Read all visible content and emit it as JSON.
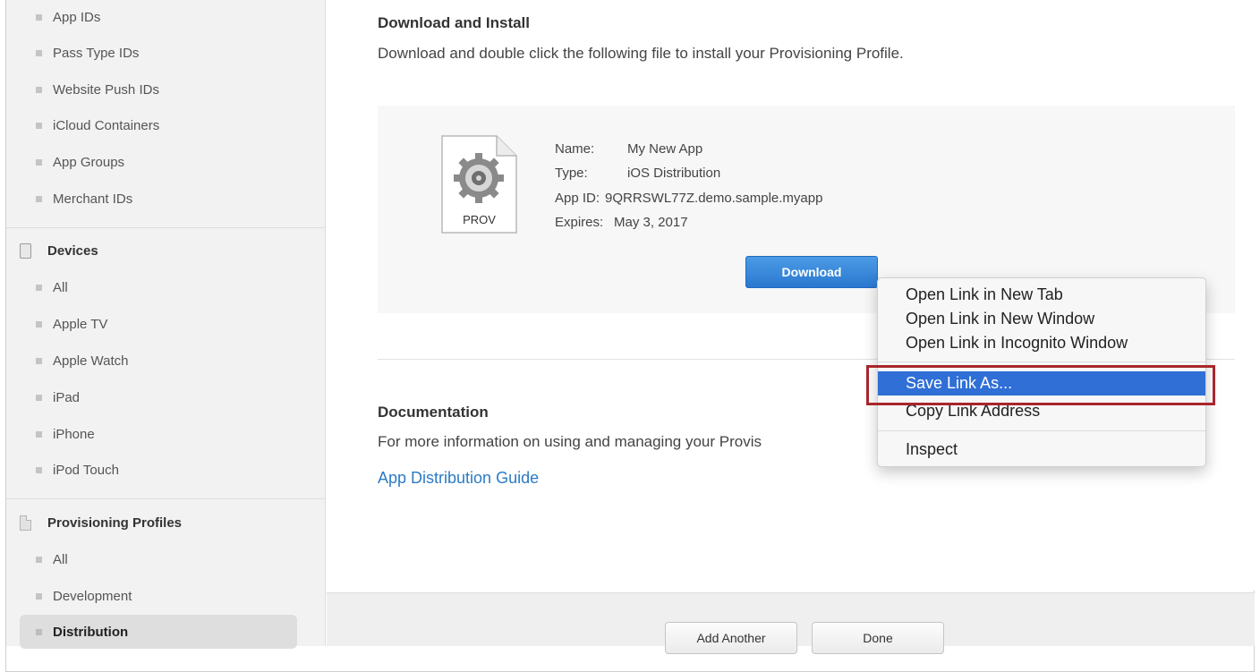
{
  "sidebar": {
    "ids_items": [
      "App IDs",
      "Pass Type IDs",
      "Website Push IDs",
      "iCloud Containers",
      "App Groups",
      "Merchant IDs"
    ],
    "devices_title": "Devices",
    "devices_items": [
      "All",
      "Apple TV",
      "Apple Watch",
      "iPad",
      "iPhone",
      "iPod Touch"
    ],
    "profiles_title": "Provisioning Profiles",
    "profiles_items": [
      "All",
      "Development",
      "Distribution"
    ]
  },
  "download": {
    "title": "Download and Install",
    "description": "Download and double click the following file to install your Provisioning Profile.",
    "file_label": "PROV",
    "name_label": "Name:",
    "name_value": "My New App",
    "type_label": "Type:",
    "type_value": "iOS Distribution",
    "appid_label": "App ID:",
    "appid_value": "9QRRSWL77Z.demo.sample.myapp",
    "expires_label": "Expires:",
    "expires_value": "May 3, 2017",
    "button": "Download"
  },
  "documentation": {
    "title": "Documentation",
    "text": "For more information on using and managing your Provis",
    "link": "App Distribution Guide"
  },
  "footer": {
    "add_another": "Add Another",
    "done": "Done"
  },
  "context_menu": {
    "open_new_tab": "Open Link in New Tab",
    "open_new_window": "Open Link in New Window",
    "open_incognito": "Open Link in Incognito Window",
    "save_link_as": "Save Link As...",
    "copy_link": "Copy Link Address",
    "inspect": "Inspect"
  },
  "colors": {
    "accent_blue": "#2f6fd6",
    "highlight_red": "#a8262c",
    "link_blue": "#2b7bc4"
  }
}
